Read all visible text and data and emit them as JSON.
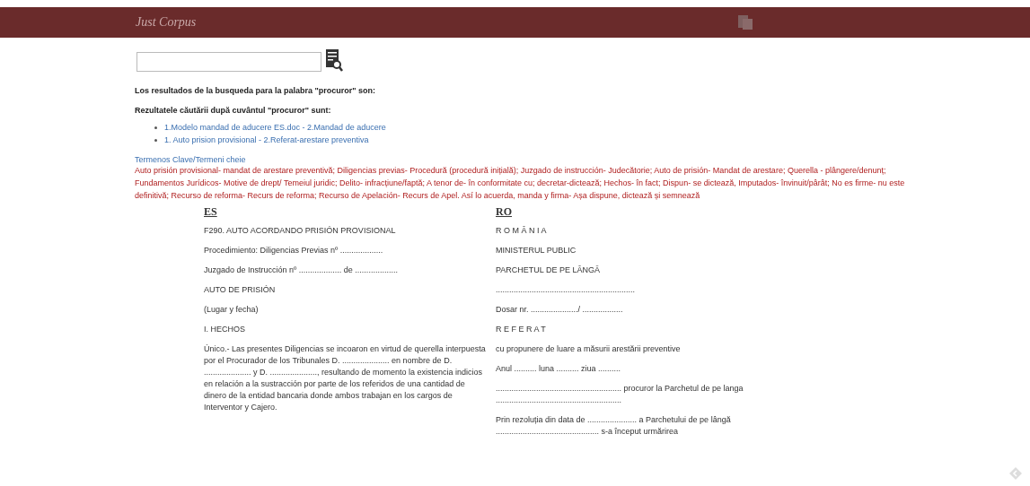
{
  "header": {
    "title": "Just Corpus"
  },
  "results": {
    "heading_es": "Los resultados de la busqueda para la palabra \"procuror\" son:",
    "heading_ro": "Rezultatele căutării după cuvântul \"procuror\" sunt:",
    "links": [
      "1.Modelo mandad de aducere ES.doc - 2.Mandad de aducere",
      "1. Auto prision provisional - 2.Referat-arestare preventiva"
    ]
  },
  "keywords": {
    "title": "Termenos Clave/Termeni cheie",
    "text": "Auto prisión provisional- mandat de arestare preventivă; Diligencias previas- Procedură (procedură inițială); Juzgado de instrucción- Judecătorie; Auto de prisión- Mandat de arestare; Querella - plângere/denunț; Fundamentos Jurídicos- Motive de drept/ Temeiul juridic; Delito- infracțiune/faptă; A tenor de- în conformitate cu; decretar-dictează; Hechos- în fact; Dispun- se dictează, Imputados- învinuit/pârât; No es firme- nu este definitivă; Recurso de reforma- Recurs de reforma; Recurso de Apelación- Recurs de Apel. Así lo acuerda, manda y firma- Așa dispune, dictează și semnează"
  },
  "columns": [
    {
      "heading": "ES",
      "paragraphs": [
        "F290. AUTO ACORDANDO PRISIÓN PROVISIONAL",
        "Procedimiento: Diligencias Previas nº ...................",
        "Juzgado de Instrucción nº ................... de ...................",
        "AUTO DE PRISIÓN",
        "(Lugar y fecha)",
        "I. HECHOS",
        "Único.- Las presentes Diligencias se incoaron en virtud de querella interpuesta por el Procurador de los Tribunales D. ..................... en nombre de D. ..................... y D. ....................., resultando de momento la existencia indicios en relación a la sustracción por parte de los referidos de una cantidad de dinero de la entidad bancaria donde ambos trabajan en los cargos de Interventor y Cajero."
      ]
    },
    {
      "heading": "RO",
      "paragraphs": [
        "R O M Â N I A",
        "MINISTERUL PUBLIC",
        "PARCHETUL DE PE LÂNGĂ",
        "..............................................................",
        "Dosar nr. ...................../ ..................",
        "R E F E R A T",
        "cu propunere de luare a măsurii arestării preventive",
        "Anul .......... luna .......... ziua ..........",
        "........................................................ procuror la Parchetul de pe langa ........................................................",
        "Prin rezoluția din data de ...................... a Parchetului de pe lângă .............................................. s-a început urmărirea"
      ]
    }
  ]
}
